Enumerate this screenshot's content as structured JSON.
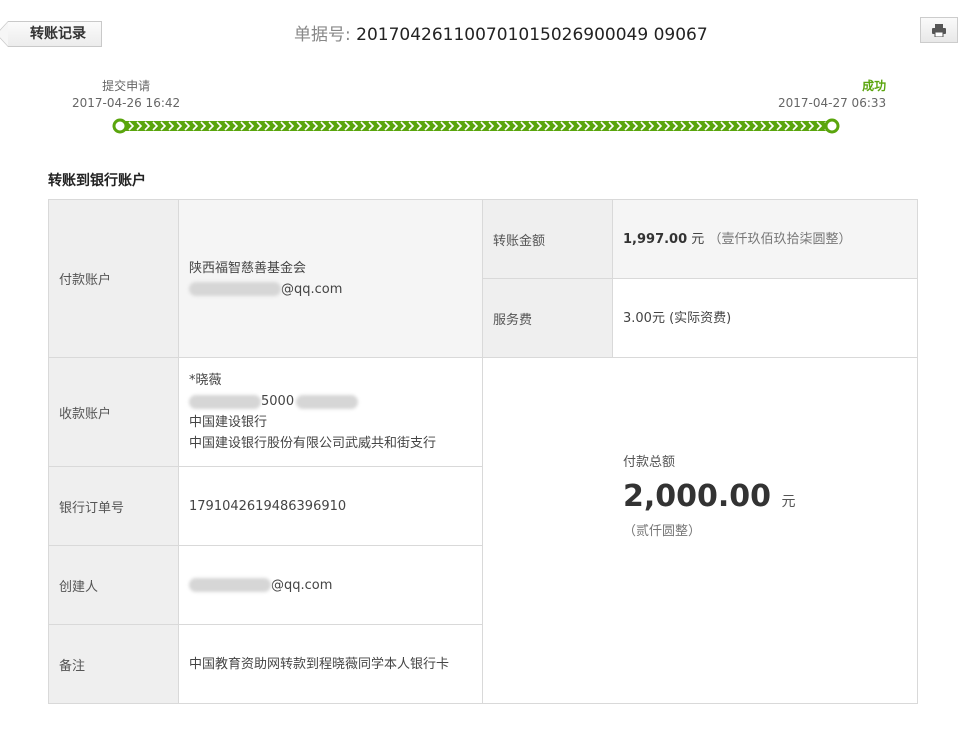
{
  "header": {
    "back_label": "转账记录",
    "doc_label": "单据号: ",
    "doc_number": "201704261100701015026900049 09067",
    "print_icon": "printer-icon"
  },
  "progress": {
    "start": {
      "title": "提交申请",
      "time": "2017-04-26 16:42"
    },
    "end": {
      "title": "成功",
      "time": "2017-04-27 06:33"
    },
    "accent": "#5aa50d"
  },
  "section_title": "转账到银行账户",
  "payer": {
    "label": "付款账户",
    "name": "陕西福智慈善基金会",
    "email_suffix": "@qq.com"
  },
  "transfer_amount": {
    "label": "转账金额",
    "amount": "1,997.00",
    "unit": "元",
    "chinese": "（壹仟玖佰玖拾柒圆整）"
  },
  "fee": {
    "label": "服务费",
    "value": "3.00元 (实际资费)"
  },
  "payee": {
    "label": "收款账户",
    "name": "*晓薇",
    "account_partial": "5000",
    "bank": "中国建设银行",
    "branch": "中国建设银行股份有限公司武威共和街支行"
  },
  "order": {
    "label": "银行订单号",
    "value": "1791042619486396910"
  },
  "creator": {
    "label": "创建人",
    "email_suffix": "@qq.com"
  },
  "remark": {
    "label": "备注",
    "value": "中国教育资助网转款到程晓薇同学本人银行卡"
  },
  "total": {
    "label": "付款总额",
    "amount": "2,000.00",
    "unit": "元",
    "chinese": "（贰仟圆整）"
  }
}
